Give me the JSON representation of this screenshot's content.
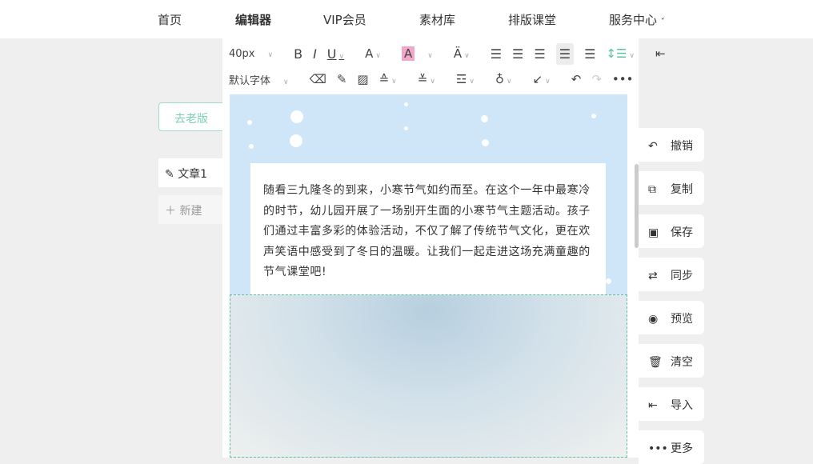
{
  "nav": [
    "首页",
    "编辑器",
    "VIP会员",
    "素材库",
    "排版课堂",
    "服务中心"
  ],
  "sidebar": {
    "old_version": "去老版",
    "doc": "文章1",
    "new": "新建"
  },
  "toolbar": {
    "font_size": "40px",
    "font_family": "默认字体"
  },
  "article_text": "随看三九隆冬的到来，小寒节气如约而至。在这个一年中最寒冷的时节，幼儿园开展了一场别开生面的小寒节气主题活动。孩子们通过丰富多彩的体验活动，不仅了解了传统节气文化，更在欢声笑语中感受到了冬日的温暖。让我们一起走进这场充满童趣的节气课堂吧!",
  "right_actions": [
    {
      "label": "撤销",
      "icon": "undo-icon",
      "glyph": "↶"
    },
    {
      "label": "复制",
      "icon": "copy-icon",
      "glyph": "⧉"
    },
    {
      "label": "保存",
      "icon": "save-icon",
      "glyph": "▣"
    },
    {
      "label": "同步",
      "icon": "sync-icon",
      "glyph": "⇄"
    },
    {
      "label": "预览",
      "icon": "eye-icon",
      "glyph": "◉"
    },
    {
      "label": "清空",
      "icon": "trash-icon",
      "glyph": "🗑"
    },
    {
      "label": "导入",
      "icon": "import-icon",
      "glyph": "⇤"
    },
    {
      "label": "更多",
      "icon": "more-icon",
      "glyph": "•••"
    }
  ],
  "colors": {
    "accent": "#5cc3a0",
    "highlight": "#f0a7c9",
    "snow_bg": "#cfe5f8"
  }
}
